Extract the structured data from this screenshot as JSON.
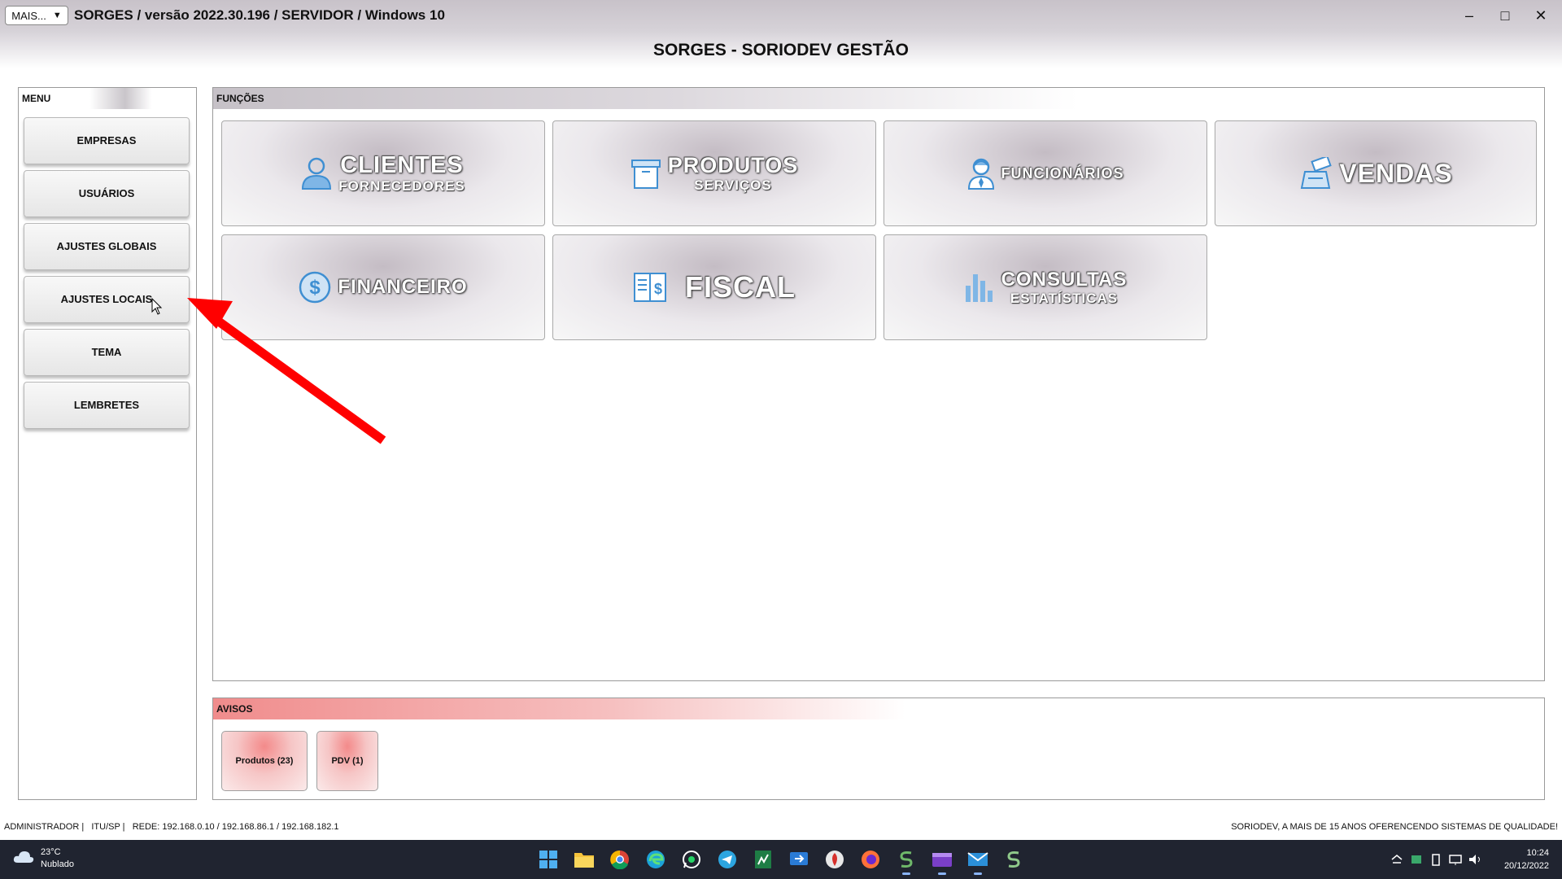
{
  "window": {
    "mais_label": "MAIS...",
    "mais_arrow": "▼",
    "title": "SORGES / versão 2022.30.196 / SERVIDOR / Windows 10",
    "minimize": "–",
    "maximize": "□",
    "close": "✕"
  },
  "main_title": "SORGES - SORIODEV GESTÃO",
  "menu": {
    "header": "MENU",
    "items": [
      "EMPRESAS",
      "USUÁRIOS",
      "AJUSTES GLOBAIS",
      "AJUSTES LOCAIS",
      "TEMA",
      "LEMBRETES"
    ]
  },
  "functions": {
    "header": "FUNÇÕES",
    "tiles": [
      {
        "main": "CLIENTES",
        "sub": "FORNECEDORES",
        "icon": "user-icon"
      },
      {
        "main": "PRODUTOS",
        "sub": "SERVIÇOS",
        "icon": "box-icon"
      },
      {
        "main": "FUNCIONÁRIOS",
        "sub": "",
        "icon": "employee-icon"
      },
      {
        "main": "VENDAS",
        "sub": "",
        "icon": "cash-register-icon"
      },
      {
        "main": "FINANCEIRO",
        "sub": "",
        "icon": "dollar-icon"
      },
      {
        "main": "FISCAL",
        "sub": "",
        "icon": "fiscal-book-icon"
      },
      {
        "main": "CONSULTAS",
        "sub": "ESTATÍSTICAS",
        "icon": "bar-chart-icon"
      }
    ]
  },
  "avisos": {
    "header": "AVISOS",
    "items": [
      "Produtos (23)",
      "PDV (1)"
    ]
  },
  "status": {
    "left": "ADMINISTRADOR |   ITU/SP |   REDE: 192.168.0.10 / 192.168.86.1 / 192.168.182.1",
    "right": "SORIODEV, A MAIS DE 15 ANOS OFERENCENDO SISTEMAS DE QUALIDADE!"
  },
  "taskbar": {
    "weather_temp": "23°C",
    "weather_desc": "Nublado",
    "time": "10:24",
    "date": "20/12/2022",
    "apps": [
      "start-icon",
      "file-explorer-icon",
      "chrome-icon",
      "edge-icon",
      "whatsapp-icon",
      "telegram-icon",
      "spreadsheet-icon",
      "remote-icon",
      "app-icon",
      "firefox-icon",
      "sorges-icon",
      "video-editor-icon",
      "mail-icon",
      "sorges-alt-icon"
    ]
  },
  "colors": {
    "accent_red": "#ff0000",
    "avisos_header": "#f08c8c",
    "taskbar": "#202430",
    "icon_blue": "#3f8fd2"
  }
}
